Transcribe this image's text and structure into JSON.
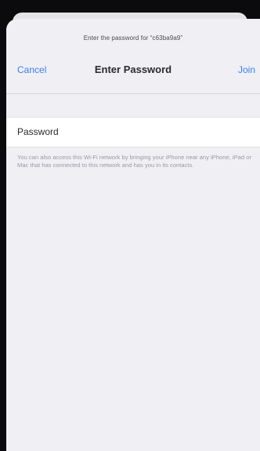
{
  "prompt": {
    "text": "Enter the password for “c63ba9a9”"
  },
  "navbar": {
    "cancel_label": "Cancel",
    "title": "Enter Password",
    "join_label": "Join"
  },
  "password_field": {
    "label": "Password",
    "value": ""
  },
  "footnote": {
    "text": "You can also access this Wi-Fi network by bringing your iPhone near any iPhone, iPad or Mac that has connected to this network and has you in its contacts."
  },
  "colors": {
    "accent": "#3b7ff2",
    "background": "#efeff4",
    "frame": "#0b0b0d"
  }
}
